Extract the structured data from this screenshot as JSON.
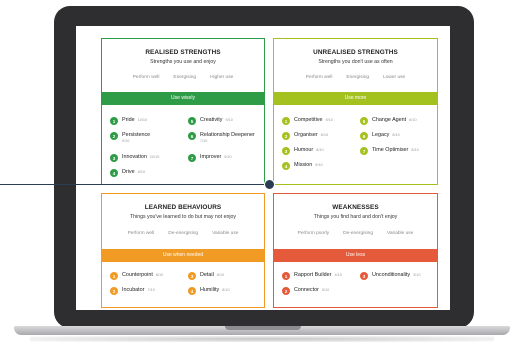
{
  "quadrants": {
    "realised": {
      "title": "REALISED STRENGTHS",
      "subtitle": "Strengths you use and enjoy",
      "columns": [
        "Perform well",
        "Energising",
        "Higher use"
      ],
      "bar_label": "Use wisely",
      "color": "#2e9b47",
      "items": [
        {
          "num": "1",
          "label": "Pride",
          "score": "10/10"
        },
        {
          "num": "2",
          "label": "Persistence",
          "score": "9/10"
        },
        {
          "num": "3",
          "label": "Innovation",
          "score": "10/10"
        },
        {
          "num": "4",
          "label": "Drive",
          "score": "8/10"
        },
        {
          "num": "5",
          "label": "Creativity",
          "score": "9/10"
        },
        {
          "num": "6",
          "label": "Relationship Deepener",
          "score": "7/10"
        },
        {
          "num": "7",
          "label": "Improver",
          "score": "9/10"
        }
      ]
    },
    "unrealised": {
      "title": "UNREALISED STRENGTHS",
      "subtitle": "Strengths you don't use as often",
      "columns": [
        "Perform well",
        "Energising",
        "Lower use"
      ],
      "bar_label": "Use more",
      "color": "#a4c21f",
      "items": [
        {
          "num": "1",
          "label": "Competitive",
          "score": "9/10"
        },
        {
          "num": "2",
          "label": "Organiser",
          "score": "8/10"
        },
        {
          "num": "3",
          "label": "Humour",
          "score": "8/10"
        },
        {
          "num": "4",
          "label": "Mission",
          "score": "9/10"
        },
        {
          "num": "5",
          "label": "Change Agent",
          "score": "8/10"
        },
        {
          "num": "6",
          "label": "Legacy",
          "score": "8/10"
        },
        {
          "num": "7",
          "label": "Time Optimiser",
          "score": "8/10"
        }
      ]
    },
    "learned": {
      "title": "LEARNED BEHAVIOURS",
      "subtitle": "Things you've learned to do but may not enjoy",
      "columns": [
        "Perform well",
        "De-energising",
        "Variable use"
      ],
      "bar_label": "Use when needed",
      "color": "#f19a24",
      "items": [
        {
          "num": "1",
          "label": "Counterpoint",
          "score": "8/10"
        },
        {
          "num": "2",
          "label": "Incubator",
          "score": "7/10"
        },
        {
          "num": "3",
          "label": "Detail",
          "score": "8/10"
        },
        {
          "num": "4",
          "label": "Humility",
          "score": "8/10"
        }
      ]
    },
    "weaknesses": {
      "title": "WEAKNESSES",
      "subtitle": "Things you find hard and don't enjoy",
      "columns": [
        "Perform poorly",
        "De-energising",
        "Variable use"
      ],
      "bar_label": "Use less",
      "color": "#e55a3a",
      "items": [
        {
          "num": "1",
          "label": "Rapport Builder",
          "score": "4/10"
        },
        {
          "num": "2",
          "label": "Connector",
          "score": "5/10"
        },
        {
          "num": "3",
          "label": "Unconditionality",
          "score": "3/10"
        }
      ]
    }
  }
}
